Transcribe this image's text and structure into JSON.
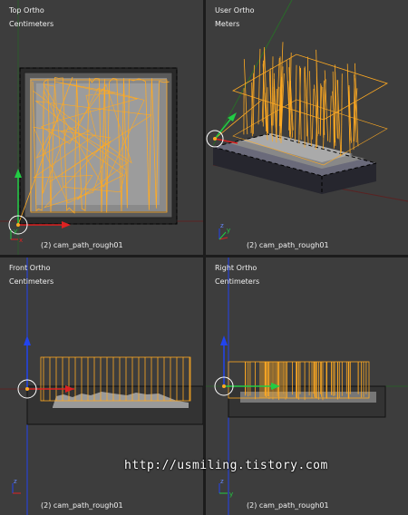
{
  "viewports": [
    {
      "name": "Top Ortho",
      "units": "Centimeters",
      "object": "(2) cam_path_rough01"
    },
    {
      "name": "User Ortho",
      "units": "Meters",
      "object": "(2) cam_path_rough01"
    },
    {
      "name": "Front Ortho",
      "units": "Centimeters",
      "object": "(2) cam_path_rough01"
    },
    {
      "name": "Right Ortho",
      "units": "Centimeters",
      "object": "(2) cam_path_rough01"
    }
  ],
  "axis_labels": {
    "x": "x",
    "y": "y",
    "z": "z"
  },
  "watermark": "http://usmiling.tistory.com",
  "colors": {
    "background": "#3d3d3d",
    "toolpath": "#ffaa22",
    "x_axis": "#dd2222",
    "y_axis": "#22cc44",
    "z_axis": "#2244ee"
  }
}
